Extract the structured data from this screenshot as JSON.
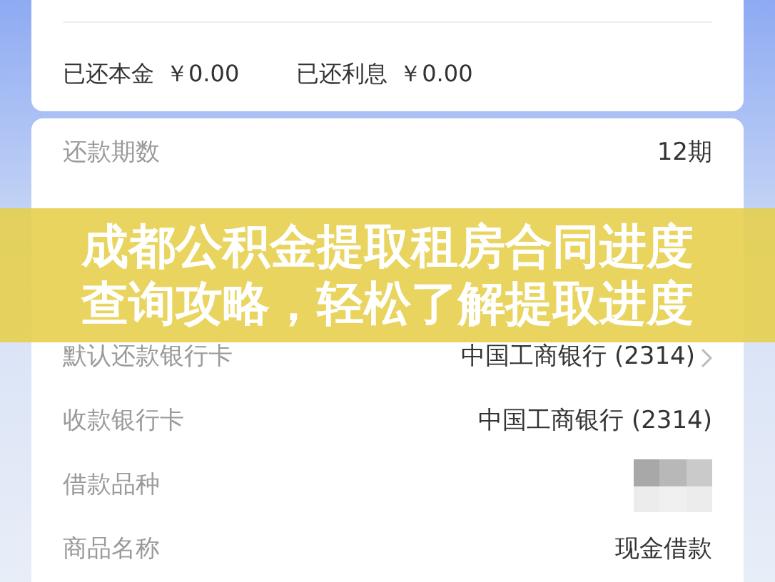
{
  "summary": {
    "paid_principal_label": "已还本金",
    "paid_principal": "￥0.00",
    "paid_interest_label": "已还利息",
    "paid_interest": "￥0.00"
  },
  "details": [
    {
      "kind": "text",
      "label": "还款期数",
      "value": "12期",
      "chevron": false
    },
    {
      "kind": "hidden"
    },
    {
      "kind": "hidden"
    },
    {
      "kind": "text",
      "label": "默认还款银行卡",
      "value": "中国工商银行 (2314)",
      "chevron": true
    },
    {
      "kind": "text",
      "label": "收款银行卡",
      "value": "中国工商银行 (2314)",
      "chevron": false
    },
    {
      "kind": "blurred",
      "label": "借款品种"
    },
    {
      "kind": "text",
      "label": "商品名称",
      "value": "现金借款",
      "chevron": false
    }
  ],
  "banner": {
    "lines": [
      "成都公积金提取租房合同进度",
      "查询攻略，轻松了解提取进度"
    ]
  }
}
